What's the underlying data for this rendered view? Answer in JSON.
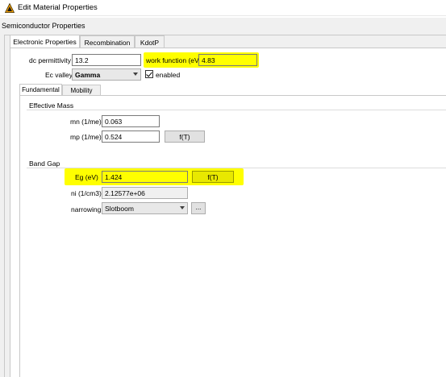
{
  "window": {
    "title": "Edit Material Properties"
  },
  "group": {
    "title": "Semiconductor Properties"
  },
  "tabs": [
    {
      "label": "Electronic Properties",
      "active": true
    },
    {
      "label": "Recombination",
      "active": false
    },
    {
      "label": "KdotP",
      "active": false
    }
  ],
  "electronic": {
    "dc_permittivity": {
      "label": "dc permittivity",
      "value": "13.2"
    },
    "work_function": {
      "label": "work function (eV)",
      "value": "4.83"
    },
    "ec_valley": {
      "label": "Ec valley",
      "selected": "Gamma"
    },
    "enabled": {
      "label": "enabled",
      "checked": true
    }
  },
  "subtabs": [
    {
      "label": "Fundamental",
      "active": true
    },
    {
      "label": "Mobility",
      "active": false
    }
  ],
  "effective_mass": {
    "title": "Effective Mass",
    "mn": {
      "label": "mn (1/me)",
      "value": "0.063"
    },
    "mp": {
      "label": "mp (1/me)",
      "value": "0.524"
    },
    "fT_label": "f(T)"
  },
  "band_gap": {
    "title": "Band Gap",
    "eg": {
      "label": "Eg (eV)",
      "value": "1.424"
    },
    "fT_label": "f(T)",
    "ni": {
      "label": "ni (1/cm3)",
      "value": "2.12577e+06"
    },
    "narrowing": {
      "label": "narrowing",
      "selected": "Slotboom"
    },
    "more_label": "..."
  },
  "colors": {
    "highlight": "#ffff00",
    "window_bg": "#f0f0f0",
    "panel_bg": "#ffffff"
  }
}
